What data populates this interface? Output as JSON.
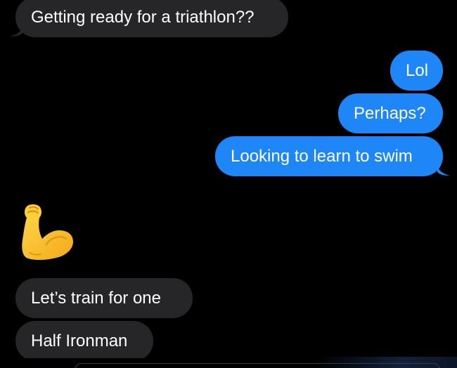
{
  "messages": {
    "m1": {
      "text": "Getting ready for a triathlon??",
      "sender": "them"
    },
    "m2": {
      "text": "Lol",
      "sender": "me"
    },
    "m3": {
      "text": "Perhaps?",
      "sender": "me"
    },
    "m4": {
      "text": "Looking to learn to swim",
      "sender": "me"
    },
    "m5": {
      "emoji": "flexed-biceps",
      "sender": "them"
    },
    "m6": {
      "text": "Let’s train for one",
      "sender": "them"
    },
    "m7": {
      "text": "Half Ironman",
      "sender": "them"
    }
  },
  "colors": {
    "background": "#000000",
    "incoming_bubble": "#262628",
    "outgoing_bubble": "#1f86f8",
    "text": "#ffffff"
  }
}
